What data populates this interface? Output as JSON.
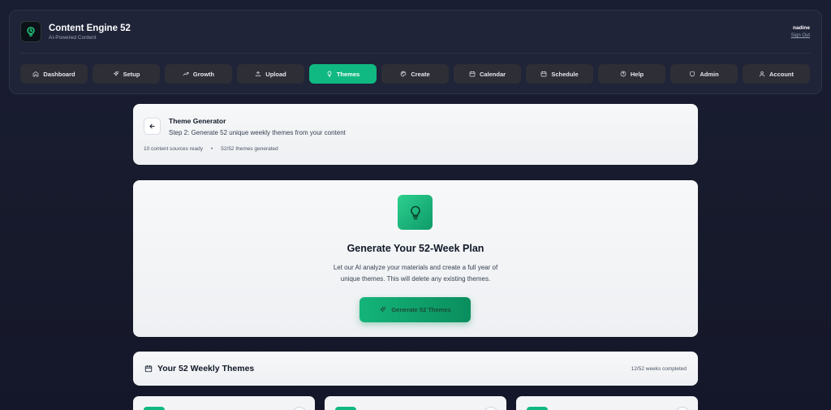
{
  "app": {
    "title": "Content Engine 52",
    "subtitle": "AI-Powered Content",
    "logo_icon": "lightbulb-icon"
  },
  "user": {
    "name": "nadine",
    "sign_out_label": "Sign Out"
  },
  "nav": {
    "active": "Themes",
    "items": [
      {
        "label": "Dashboard",
        "icon": "home-icon"
      },
      {
        "label": "Setup",
        "icon": "sparkles-icon"
      },
      {
        "label": "Growth",
        "icon": "trending-up-icon"
      },
      {
        "label": "Upload",
        "icon": "upload-icon"
      },
      {
        "label": "Themes",
        "icon": "lightbulb-icon"
      },
      {
        "label": "Create",
        "icon": "palette-icon"
      },
      {
        "label": "Calendar",
        "icon": "calendar-icon"
      },
      {
        "label": "Schedule",
        "icon": "calendar-icon"
      },
      {
        "label": "Help",
        "icon": "help-circle-icon"
      },
      {
        "label": "Admin",
        "icon": "shield-icon"
      },
      {
        "label": "Account",
        "icon": "user-icon"
      }
    ]
  },
  "theme_generator": {
    "title": "Theme Generator",
    "subtitle": "Step 2: Generate 52 unique weekly themes from your content",
    "sources_ready": "10 content sources ready",
    "separator": "•",
    "themes_generated": "52/52 themes generated"
  },
  "generate": {
    "icon": "lightbulb-icon",
    "title": "Generate Your 52-Week Plan",
    "description_line1": "Let our AI analyze your materials and create a full year of",
    "description_line2": "unique themes. This will delete any existing themes.",
    "button_label": "Generate 52 Themes"
  },
  "weekly_themes": {
    "title": "Your 52 Weekly Themes",
    "progress": "12/52 weeks completed"
  },
  "colors": {
    "accent": "#10b981",
    "background": "#1a1e33",
    "header_bg": "#1f2438",
    "nav_btn_bg": "#2d2e36"
  }
}
